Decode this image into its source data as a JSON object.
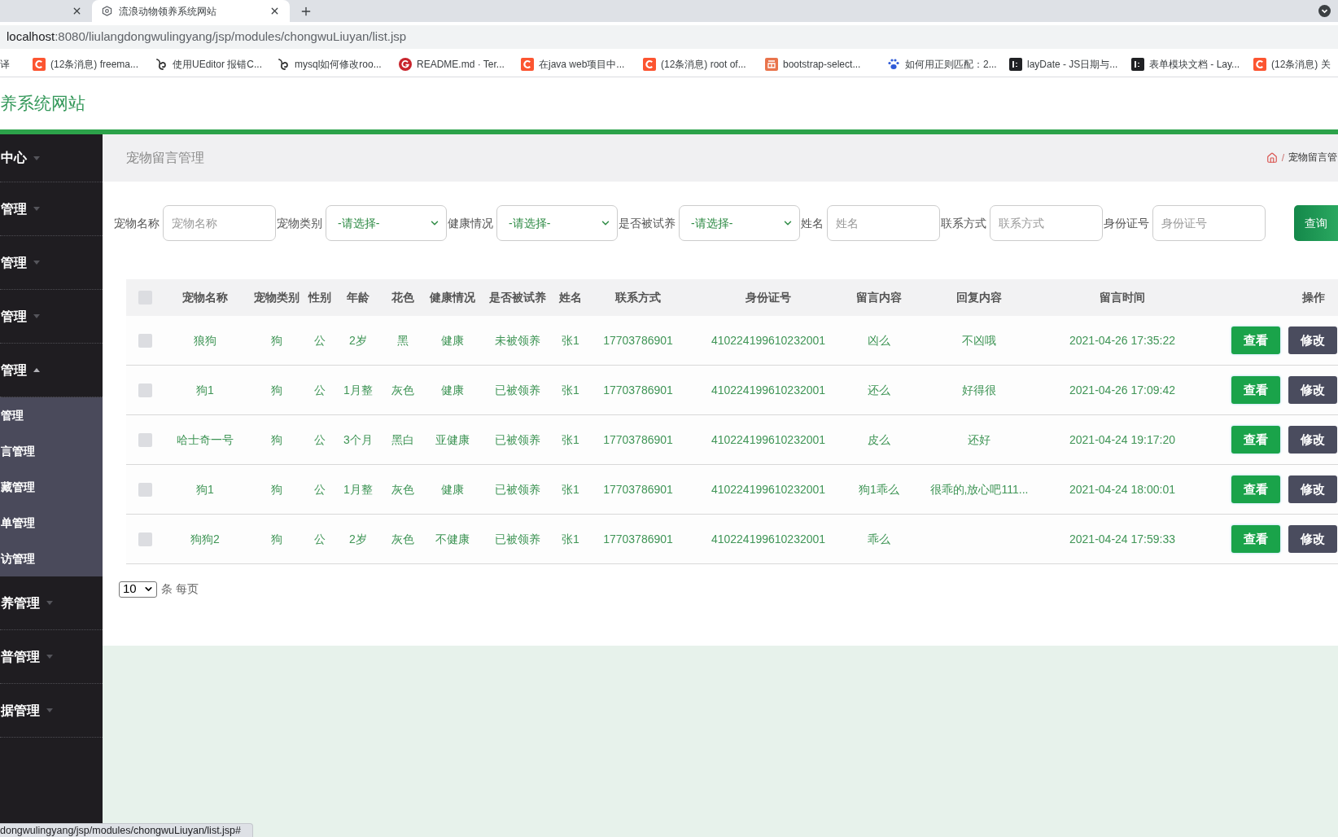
{
  "browser": {
    "tabs": [
      {
        "selected": false
      },
      {
        "title": "流浪动物领养系统网站",
        "selected": true
      }
    ],
    "address_bar": {
      "host": "localhost",
      "path": ":8080/liulangdongwulingyang/jsp/modules/chongwuLiuyan/list.jsp"
    },
    "bookmarks": [
      {
        "label": "译",
        "kind": "plain"
      },
      {
        "label": "(12条消息) freema...",
        "kind": "ctile"
      },
      {
        "label": "使用UEditor 报错C...",
        "kind": "swirl"
      },
      {
        "label": "mysql如何修改roo...",
        "kind": "swirl"
      },
      {
        "label": "README.md · Ter...",
        "kind": "gcircle"
      },
      {
        "label": "在java web项目中...",
        "kind": "ctile"
      },
      {
        "label": "(12条消息) root of...",
        "kind": "ctile"
      },
      {
        "label": "bootstrap-select...",
        "kind": "tile"
      },
      {
        "label": "如何用正则匹配：2...",
        "kind": "paw"
      },
      {
        "label": "layDate - JS日期与...",
        "kind": "darktile"
      },
      {
        "label": "表单模块文档 - Lay...",
        "kind": "darktile"
      },
      {
        "label": "(12条消息) 关",
        "kind": "ctile"
      }
    ]
  },
  "site_header": {
    "title": "养系统网站"
  },
  "sidebar": {
    "items": [
      {
        "label": "中心",
        "expanded": false
      },
      {
        "label": "管理",
        "expanded": false
      },
      {
        "label": "管理",
        "expanded": false
      },
      {
        "label": "管理",
        "expanded": false
      },
      {
        "label": "管理",
        "expanded": true,
        "children": [
          {
            "label": "管理"
          },
          {
            "label": "言管理"
          },
          {
            "label": "藏管理"
          },
          {
            "label": "单管理"
          },
          {
            "label": "访管理"
          }
        ]
      },
      {
        "label": "养管理",
        "expanded": false
      },
      {
        "label": "普管理",
        "expanded": false
      },
      {
        "label": "据管理",
        "expanded": false
      }
    ]
  },
  "breadcrumb": {
    "title": "宠物留言管理",
    "separator": "/",
    "current": "宠物留言管"
  },
  "filters": [
    {
      "label": "宠物名称",
      "kind": "input",
      "placeholder": "宠物名称"
    },
    {
      "label": "宠物类别",
      "kind": "select",
      "value": "-请选择-"
    },
    {
      "label": "健康情况",
      "kind": "select",
      "value": "-请选择-"
    },
    {
      "label": "是否被试养",
      "kind": "select",
      "value": "-请选择-"
    },
    {
      "label": "姓名",
      "kind": "input",
      "placeholder": "姓名"
    },
    {
      "label": "联系方式",
      "kind": "input",
      "placeholder": "联系方式"
    },
    {
      "label": "身份证号",
      "kind": "input",
      "placeholder": "身份证号"
    }
  ],
  "search_button": "查询",
  "table": {
    "header_checkbox": {
      "checked": false
    },
    "columns": [
      "宠物名称",
      "宠物类别",
      "性别",
      "年龄",
      "花色",
      "健康情况",
      "是否被试养",
      "姓名",
      "联系方式",
      "身份证号",
      "留言内容",
      "回复内容",
      "留言时间",
      "操作"
    ],
    "rows": [
      {
        "checked": false,
        "name": "狼狗",
        "category": "狗",
        "sex": "公",
        "age": "2岁",
        "coat": "黑",
        "health": "健康",
        "adopted": "未被领养",
        "owner": "张1",
        "phone": "17703786901",
        "id_number": "410224199610232001",
        "message": "凶么",
        "reply": "不凶哦",
        "time": "2021-04-26 17:35:22",
        "actions": [
          {
            "label": "查看",
            "kind": "view"
          },
          {
            "label": "修改",
            "kind": "edit"
          }
        ]
      },
      {
        "checked": false,
        "name": "狗1",
        "category": "狗",
        "sex": "公",
        "age": "1月整",
        "coat": "灰色",
        "health": "健康",
        "adopted": "已被领养",
        "owner": "张1",
        "phone": "17703786901",
        "id_number": "410224199610232001",
        "message": "还么",
        "reply": "好得很",
        "time": "2021-04-26 17:09:42",
        "actions": [
          {
            "label": "查看",
            "kind": "view"
          },
          {
            "label": "修改",
            "kind": "edit"
          }
        ]
      },
      {
        "checked": false,
        "name": "哈士奇一号",
        "category": "狗",
        "sex": "公",
        "age": "3个月",
        "coat": "黑白",
        "health": "亚健康",
        "adopted": "已被领养",
        "owner": "张1",
        "phone": "17703786901",
        "id_number": "410224199610232001",
        "message": "皮么",
        "reply": "还好",
        "time": "2021-04-24 19:17:20",
        "actions": [
          {
            "label": "查看",
            "kind": "view"
          },
          {
            "label": "修改",
            "kind": "edit"
          }
        ]
      },
      {
        "checked": false,
        "name": "狗1",
        "category": "狗",
        "sex": "公",
        "age": "1月整",
        "coat": "灰色",
        "health": "健康",
        "adopted": "已被领养",
        "owner": "张1",
        "phone": "17703786901",
        "id_number": "410224199610232001",
        "message": "狗1乖么",
        "reply": "很乖的,放心吧111...",
        "time": "2021-04-24 18:00:01",
        "actions": [
          {
            "label": "查看",
            "kind": "view"
          },
          {
            "label": "修改",
            "kind": "edit"
          }
        ]
      },
      {
        "checked": false,
        "name": "狗狗2",
        "category": "狗",
        "sex": "公",
        "age": "2岁",
        "coat": "灰色",
        "health": "不健康",
        "adopted": "已被领养",
        "owner": "张1",
        "phone": "17703786901",
        "id_number": "410224199610232001",
        "message": "乖么",
        "time": "2021-04-24 17:59:33",
        "actions": [
          {
            "label": "查看",
            "kind": "view"
          },
          {
            "label": "修改",
            "kind": "edit"
          }
        ]
      }
    ]
  },
  "pagination": {
    "page_size": "10",
    "label": "条 每页"
  },
  "status_bar": {
    "url": "dongwulingyang/jsp/modules/chongwuLiuyan/list.jsp#"
  }
}
